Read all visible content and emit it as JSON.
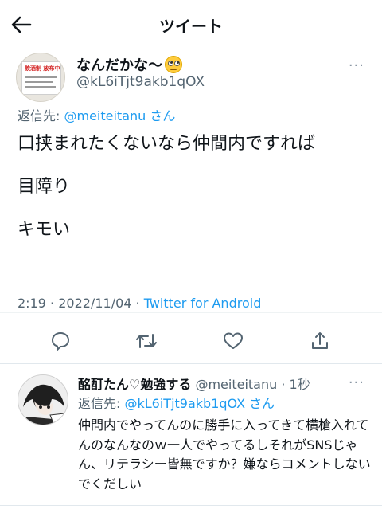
{
  "header": {
    "title": "ツイート"
  },
  "tweet": {
    "avatar_poster_text": "飲酒制 放布中",
    "display_name": "なんだかな〜",
    "handle": "@kL6iTjt9akb1qOX",
    "reply_prefix": "返信先: ",
    "reply_to_handle": "@meiteitanu",
    "reply_suffix": " さん",
    "body_lines": [
      "口挟まれたくないなら仲間内ですれば",
      "目障り",
      "キモい"
    ],
    "time": "2:19",
    "date": "2022/11/04",
    "source": "Twitter for Android",
    "sep": " · "
  },
  "icons": [
    "back-arrow-icon",
    "more-dots-icon",
    "reply-icon",
    "retweet-icon",
    "like-icon",
    "share-icon"
  ],
  "reply": {
    "display_name": "酩酊たん♡勉強する",
    "handle": "@meiteitanu",
    "time": "1秒",
    "reply_prefix": "返信先: ",
    "reply_to_handle": "@kL6iTjt9akb1qOX",
    "reply_suffix": " さん",
    "body": "仲間内でやってんのに勝手に入ってきて横槍入れてんのなんなのｗ一人でやってるしそれがSNSじゃん、リテラシー皆無ですか？嫌ならコメントしないでくだしい"
  },
  "colors": {
    "link": "#1d9bf0",
    "muted": "#536471",
    "text": "#0f1419"
  }
}
